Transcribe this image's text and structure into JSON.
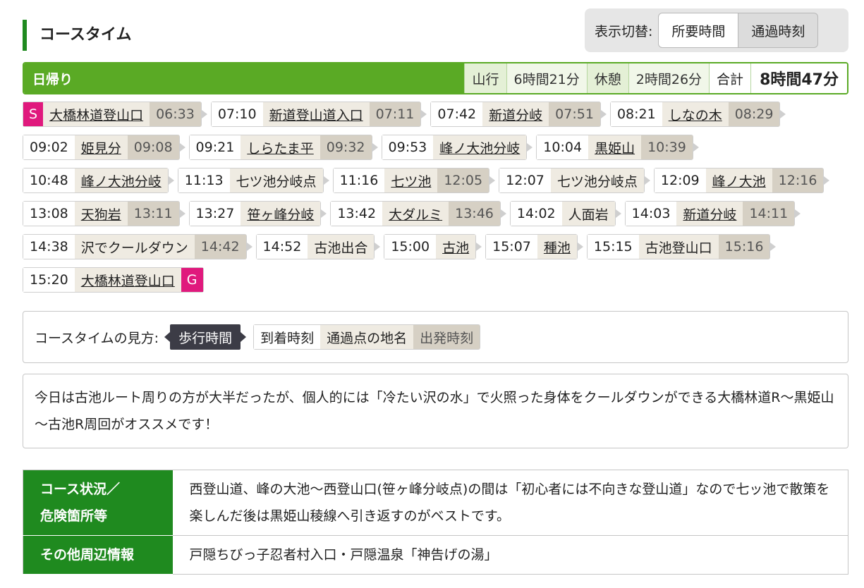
{
  "header": {
    "section_title": "コースタイム",
    "toggle_label": "表示切替:",
    "toggle_options": [
      "所要時間",
      "通過時刻"
    ],
    "toggle_active": "通過時刻"
  },
  "summary": {
    "title": "日帰り",
    "climb_label": "山行",
    "climb_value": "6時間21分",
    "rest_label": "休憩",
    "rest_value": "2時間26分",
    "total_label": "合計",
    "total_value": "8時間47分"
  },
  "timeline": [
    {
      "badge": "S",
      "name": "大橋林道登山口",
      "link": true,
      "dep": "06:33"
    },
    {
      "arr": "07:10",
      "name": "新道登山道入口",
      "link": true,
      "dep": "07:11"
    },
    {
      "arr": "07:42",
      "name": "新道分岐",
      "link": true,
      "dep": "07:51"
    },
    {
      "arr": "08:21",
      "name": "しなの木",
      "link": true,
      "dep": "08:29"
    },
    {
      "arr": "09:02",
      "name": "姫見分",
      "link": true,
      "dep": "09:08"
    },
    {
      "arr": "09:21",
      "name": "しらたま平",
      "link": true,
      "dep": "09:32"
    },
    {
      "arr": "09:53",
      "name": "峰ノ大池分岐",
      "link": true
    },
    {
      "arr": "10:04",
      "name": "黒姫山",
      "link": true,
      "dep": "10:39"
    },
    {
      "arr": "10:48",
      "name": "峰ノ大池分岐",
      "link": true
    },
    {
      "arr": "11:13",
      "name": "七ツ池分岐点",
      "link": false
    },
    {
      "arr": "11:16",
      "name": "七ツ池",
      "link": true,
      "dep": "12:05"
    },
    {
      "arr": "12:07",
      "name": "七ツ池分岐点",
      "link": false
    },
    {
      "arr": "12:09",
      "name": "峰ノ大池",
      "link": true,
      "dep": "12:16"
    },
    {
      "arr": "13:08",
      "name": "天狗岩",
      "link": true,
      "dep": "13:11"
    },
    {
      "arr": "13:27",
      "name": "笹ヶ峰分岐",
      "link": true
    },
    {
      "arr": "13:42",
      "name": "大ダルミ",
      "link": true,
      "dep": "13:46"
    },
    {
      "arr": "14:02",
      "name": "人面岩",
      "link": false
    },
    {
      "arr": "14:03",
      "name": "新道分岐",
      "link": true,
      "dep": "14:11"
    },
    {
      "arr": "14:38",
      "name": "沢でクールダウン",
      "link": false,
      "dep": "14:42"
    },
    {
      "arr": "14:52",
      "name": "古池出合",
      "link": false
    },
    {
      "arr": "15:00",
      "name": "古池",
      "link": true
    },
    {
      "arr": "15:07",
      "name": "種池",
      "link": true
    },
    {
      "arr": "15:15",
      "name": "古池登山口",
      "link": false,
      "dep": "15:16"
    },
    {
      "arr": "15:20",
      "name": "大橋林道登山口",
      "link": true,
      "badge_end": "G"
    }
  ],
  "legend": {
    "label": "コースタイムの見方:",
    "walk": "歩行時間",
    "arrival": "到着時刻",
    "name": "通過点の地名",
    "departure": "出発時刻"
  },
  "comment": "今日は古池ルート周りの方が大半だったが、個人的には「冷たい沢の水」で火照った身体をクールダウンができる大橋林道R～黒姫山～古池R周回がオススメです！",
  "info": {
    "conditions_label_1": "コース状況／",
    "conditions_label_2": "危険箇所等",
    "conditions_text": "西登山道、峰の大池～西登山口(笹ヶ峰分岐点)の間は「初心者には不向きな登山道」なので七ッ池で散策を楽しんだ後は黒姫山稜線へ引き返すのがベストです。",
    "other_label": "その他周辺情報",
    "other_text": "戸隠ちびっ子忍者村入口・戸隠温泉「神告げの湯」"
  },
  "colors": {
    "accent_green": "#5aaa25",
    "dark_green": "#1f8a1f",
    "badge_magenta": "#e0197d"
  }
}
